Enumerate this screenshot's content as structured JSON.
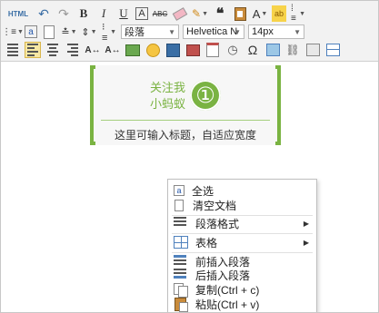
{
  "toolbar": {
    "html_label": "HTML",
    "font_size_value": "14px",
    "font_family_value": "Helvetica N",
    "paragraph_value": "段落",
    "omega_label": "Ω"
  },
  "card": {
    "title_line1": "关注我",
    "title_line2": "小蚂蚁",
    "number": "①",
    "subtitle": "这里可输入标题，自适应宽度"
  },
  "context_menu": {
    "items": [
      {
        "label": "全选"
      },
      {
        "label": "清空文档"
      },
      {
        "label": "段落格式"
      },
      {
        "label": "表格"
      },
      {
        "label": "前插入段落"
      },
      {
        "label": "后插入段落"
      },
      {
        "label": "复制(Ctrl + c)"
      },
      {
        "label": "粘贴(Ctrl + v)"
      }
    ]
  },
  "colors": {
    "accent_green": "#7ab342",
    "toolbar_bg": "#f2f2f2"
  }
}
